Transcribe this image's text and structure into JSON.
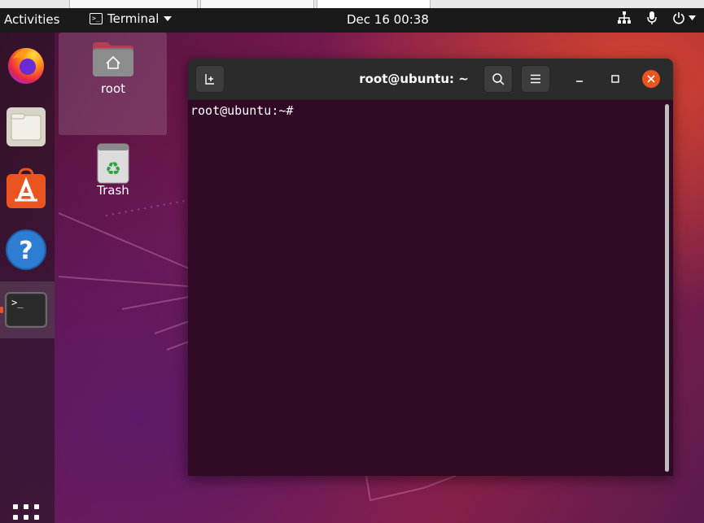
{
  "topbar": {
    "activities_label": "Activities",
    "app_menu_label": "Terminal",
    "clock": "Dec 16  00:38"
  },
  "dock": {
    "items": [
      {
        "name": "Firefox",
        "icon": "firefox-icon"
      },
      {
        "name": "Files",
        "icon": "files-icon"
      },
      {
        "name": "Ubuntu Software",
        "icon": "software-icon"
      },
      {
        "name": "Help",
        "icon": "help-icon"
      },
      {
        "name": "Terminal",
        "icon": "terminal-icon",
        "active": true
      },
      {
        "name": "Show Applications",
        "icon": "app-grid-icon"
      }
    ]
  },
  "desktop": {
    "icons": [
      {
        "label": "root",
        "icon": "home-folder-icon",
        "selected": true
      },
      {
        "label": "Trash",
        "icon": "trash-icon"
      }
    ]
  },
  "terminal": {
    "title": "root@ubuntu: ~",
    "prompt": "root@ubuntu:~#"
  },
  "colors": {
    "accent": "#e95420",
    "terminal_bg": "#300a24",
    "header_bg": "#2b2b2b",
    "topbar_bg": "#1a1a1a"
  }
}
